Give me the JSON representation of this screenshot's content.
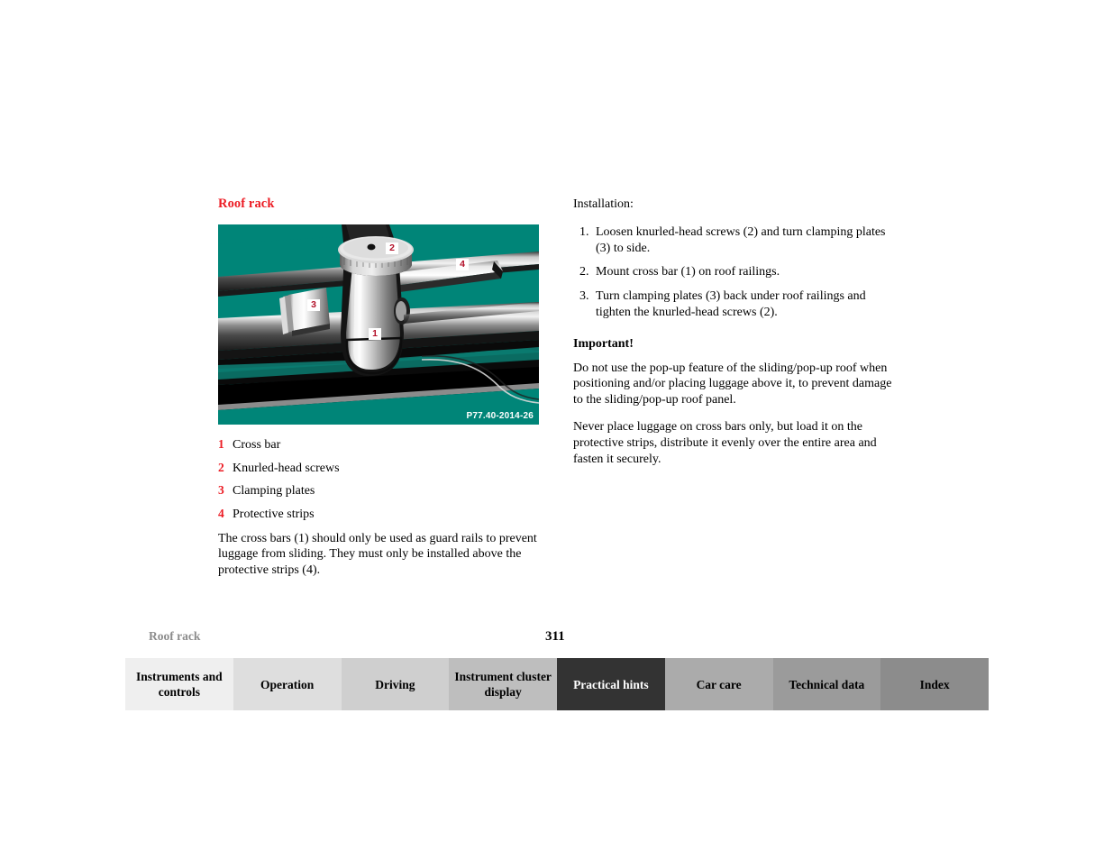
{
  "document": {
    "section_heading": "Roof rack",
    "footer_topic": "Roof rack",
    "page_number": "311"
  },
  "figure": {
    "code": "P77.40-2014-26",
    "background_color": "#008578",
    "callouts": [
      {
        "number": "2",
        "name": "callout-2-knurled-head-screws"
      },
      {
        "number": "4",
        "name": "callout-4-protective-strips"
      },
      {
        "number": "3",
        "name": "callout-3-clamping-plates"
      },
      {
        "number": "1",
        "name": "callout-1-cross-bar"
      }
    ]
  },
  "legend": {
    "items": [
      {
        "number": "1",
        "label": "Cross bar"
      },
      {
        "number": "2",
        "label": "Knurled-head screws"
      },
      {
        "number": "3",
        "label": "Clamping plates"
      },
      {
        "number": "4",
        "label": "Protective strips"
      }
    ]
  },
  "left_column": {
    "note": "The cross bars (1) should only be used as guard rails to prevent luggage from sliding. They must only be installed above the protective strips (4)."
  },
  "right_column": {
    "intro": "Installation:",
    "steps": [
      {
        "num": "1.",
        "text": "Loosen knurled-head screws (2) and turn clamping plates (3) to side."
      },
      {
        "num": "2.",
        "text": "Mount cross bar (1) on roof railings."
      },
      {
        "num": "3.",
        "text": "Turn clamping plates (3) back under roof railings and tighten the knurled-head screws (2)."
      }
    ],
    "important_heading": "Important!",
    "warning_1": "Do not use the pop-up feature of the sliding/pop-up roof when positioning and/or placing luggage above it, to prevent damage to the sliding/pop-up roof panel.",
    "warning_2": "Never place luggage on cross bars only, but load it on the protective strips, distribute it evenly over the entire area and fasten it securely."
  },
  "tabbar": {
    "tabs": [
      {
        "label": "Instruments and controls",
        "bg": "#efefef",
        "active": false
      },
      {
        "label": "Operation",
        "bg": "#dedede",
        "active": false
      },
      {
        "label": "Driving",
        "bg": "#cfcfcf",
        "active": false
      },
      {
        "label": "Instrument cluster display",
        "bg": "#bebebe",
        "active": false
      },
      {
        "label": "Practical hints",
        "bg": "#333333",
        "active": true
      },
      {
        "label": "Car care",
        "bg": "#ababab",
        "active": false
      },
      {
        "label": "Technical data",
        "bg": "#9b9b9b",
        "active": false
      },
      {
        "label": "Index",
        "bg": "#8c8c8c",
        "active": false
      }
    ]
  },
  "colors": {
    "heading_red": "#ec1c24",
    "callout_red": "#b3122a",
    "teal": "#008578",
    "footer_gray": "#8c8c8c"
  }
}
